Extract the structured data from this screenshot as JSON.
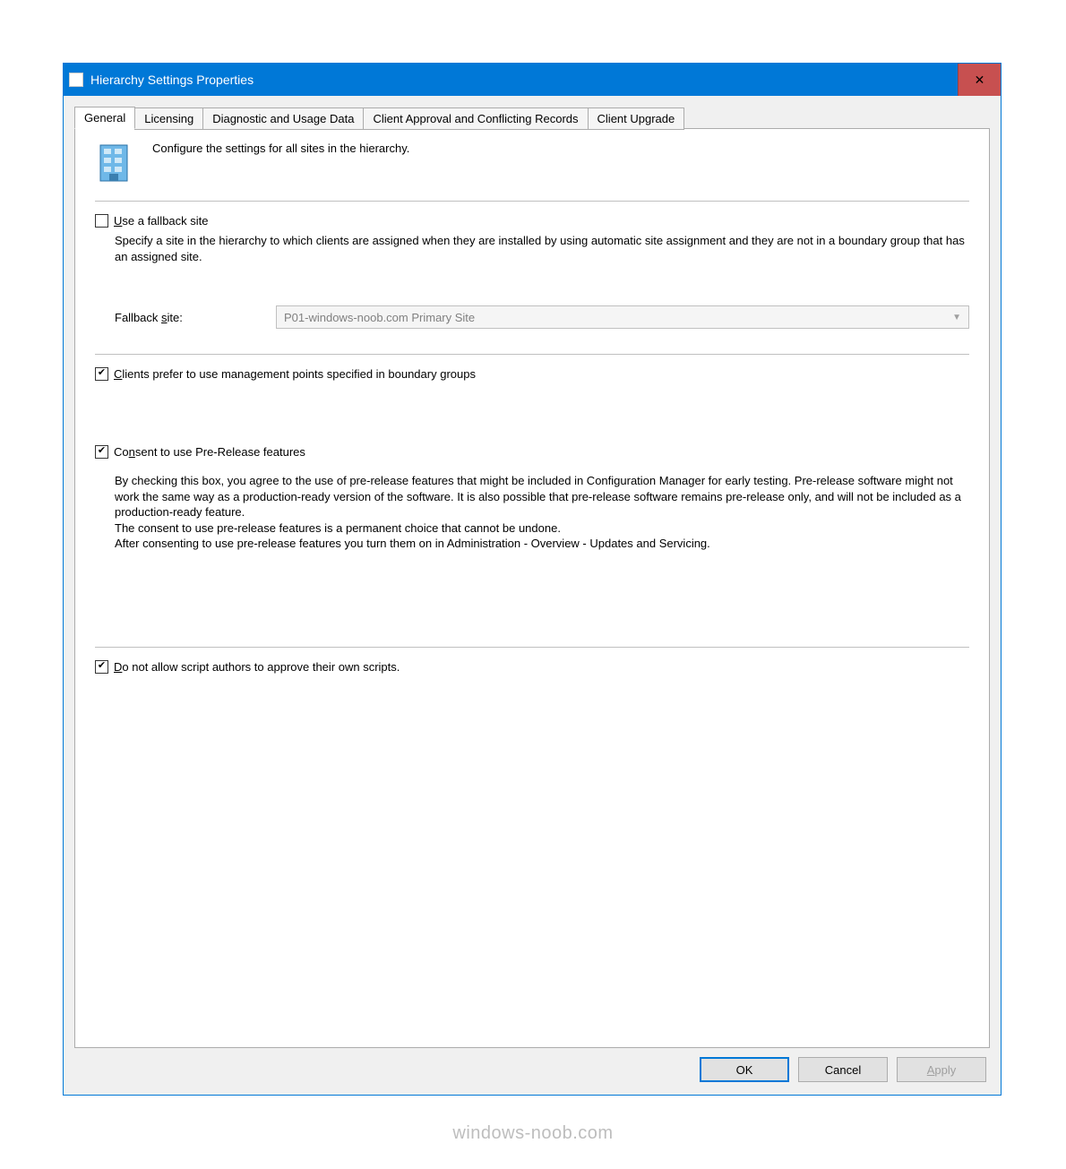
{
  "window": {
    "title": "Hierarchy Settings Properties"
  },
  "tabs": {
    "t0": "General",
    "t1": "Licensing",
    "t2": "Diagnostic and Usage Data",
    "t3": "Client Approval and Conflicting Records",
    "t4": "Client Upgrade"
  },
  "intro": {
    "text": "Configure the settings for all sites in the hierarchy."
  },
  "fallback": {
    "checkbox_label_pre": "U",
    "checkbox_label_rest": "se a fallback site",
    "desc": "Specify a site in the hierarchy to which clients are assigned when they are installed by using automatic site assignment and they are not in a boundary group that has an assigned site.",
    "field_label_pre": "Fallback ",
    "field_label_u": "s",
    "field_label_rest": "ite:",
    "combo_value": "P01-windows-noob.com Primary Site"
  },
  "clients_pref": {
    "pre": "C",
    "rest": "lients prefer to use management points specified in boundary groups"
  },
  "consent": {
    "pre": "Co",
    "u": "n",
    "rest": "sent to use Pre-Release features",
    "desc": "By checking this box, you agree to the use of pre-release features that might be included in Configuration Manager for early testing. Pre-release software might not work the same way as a production-ready version of the software. It is also possible that pre-release software remains pre-release only, and will not be included as a production-ready feature.\nThe consent to use pre-release features is a permanent choice that cannot be undone.\nAfter consenting to use pre-release features you turn them on in Administration - Overview - Updates and Servicing."
  },
  "scripts": {
    "pre": "D",
    "rest": "o not allow script authors to approve their own scripts."
  },
  "buttons": {
    "ok": "OK",
    "cancel": "Cancel",
    "apply_pre": "A",
    "apply_rest": "pply"
  },
  "watermark": "windows-noob.com"
}
